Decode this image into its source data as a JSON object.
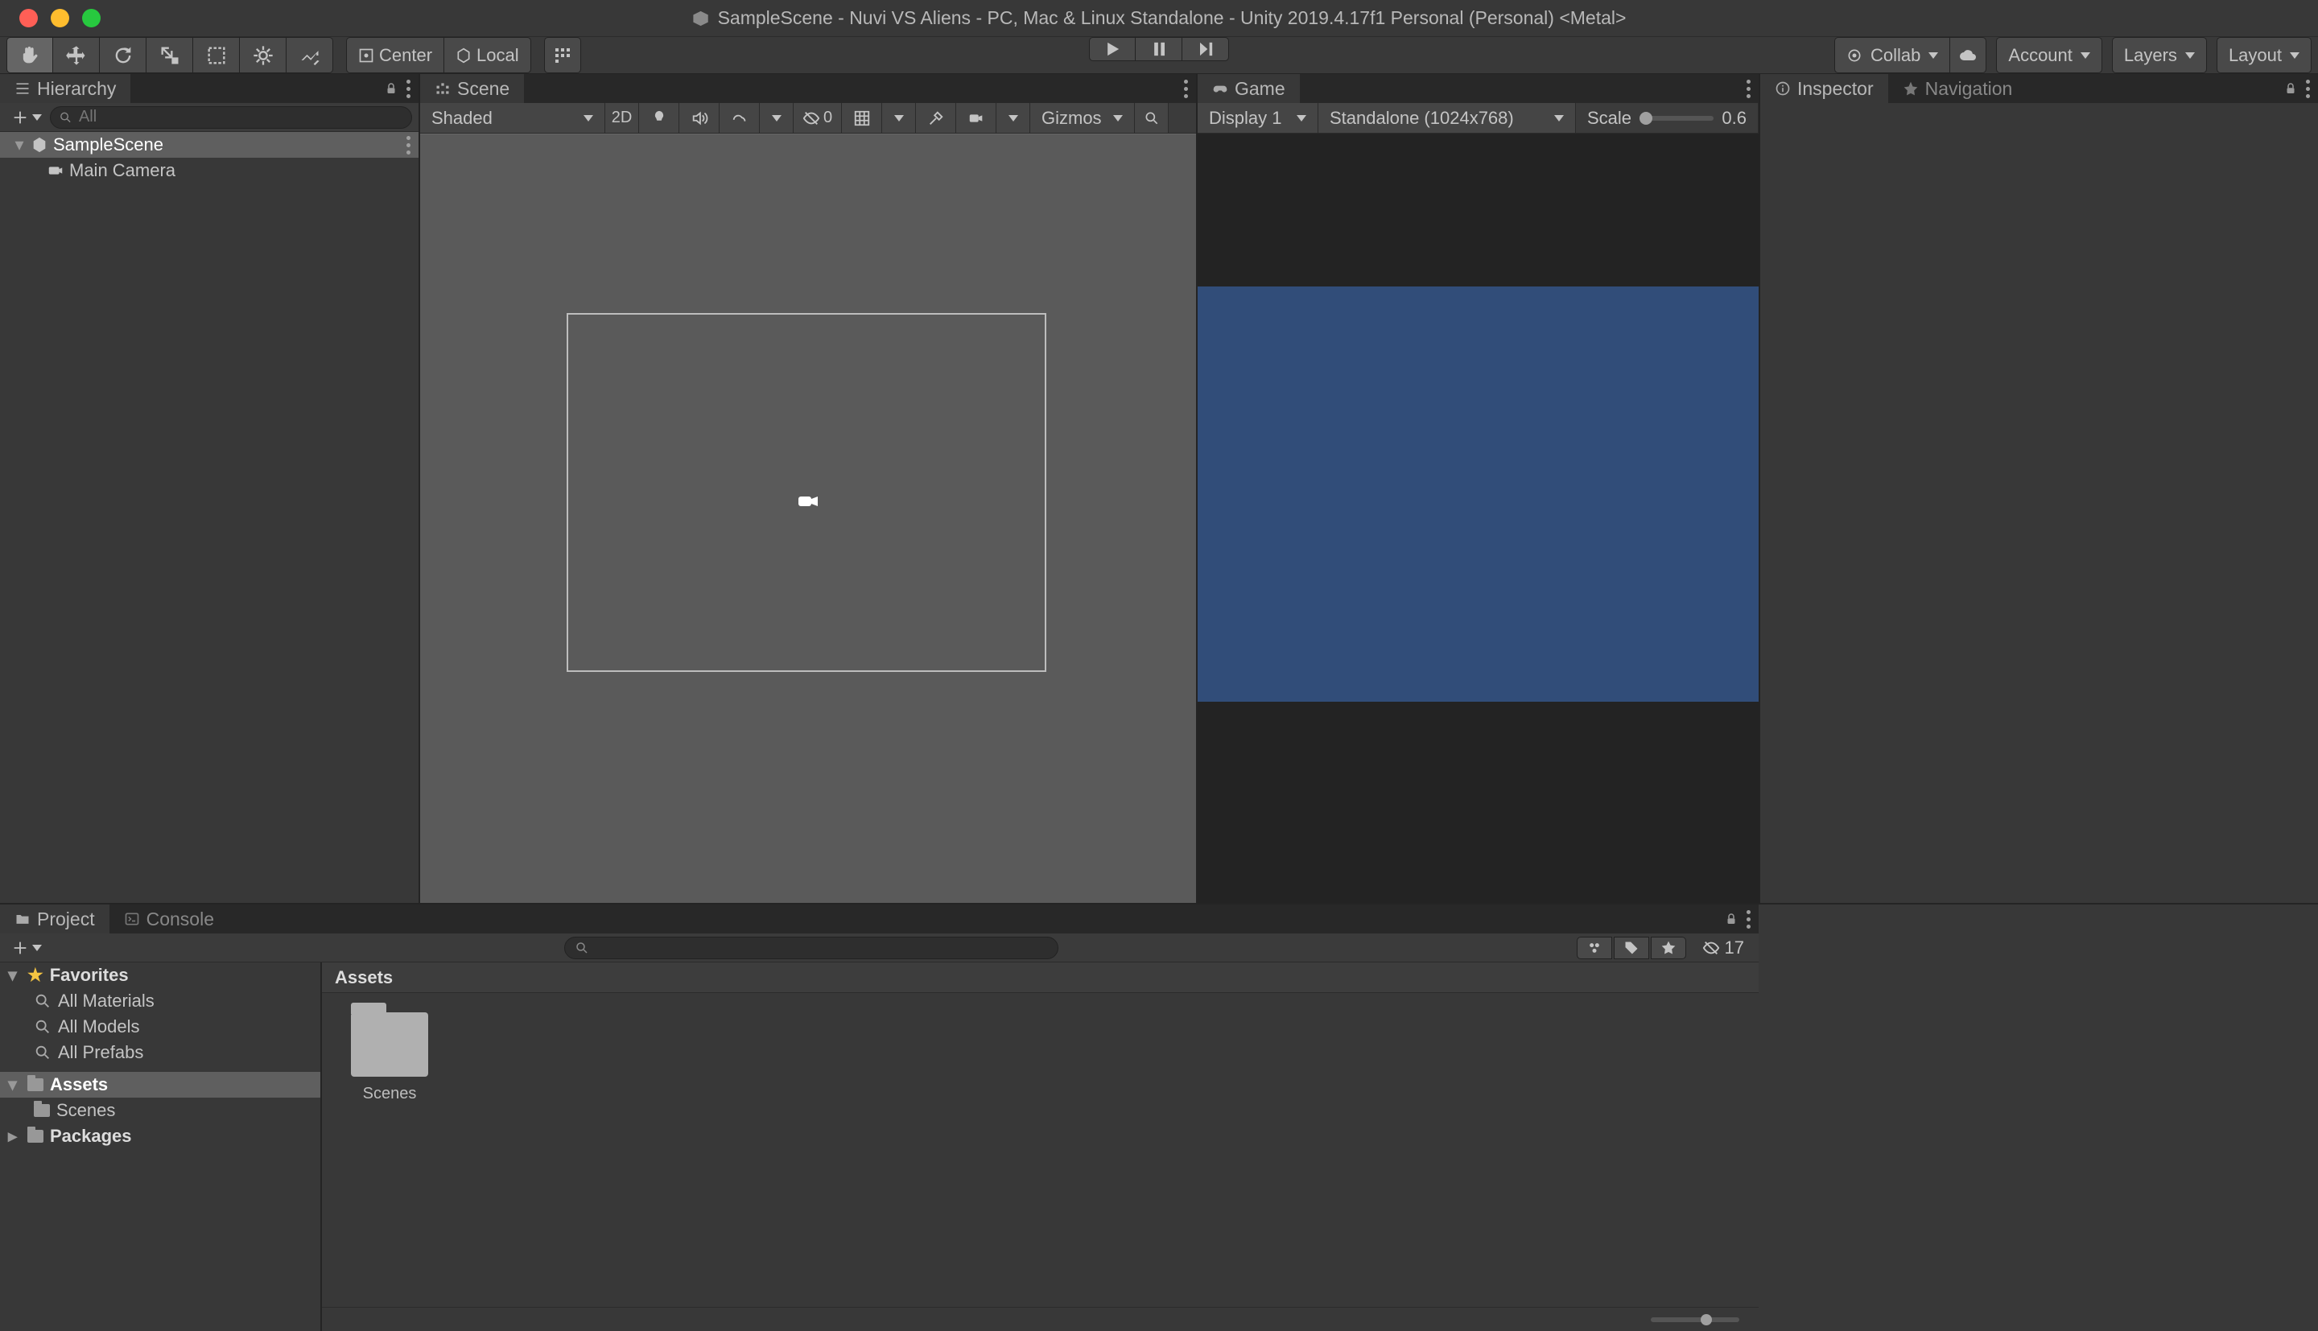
{
  "title_bar": {
    "title": "SampleScene - Nuvi VS Aliens - PC, Mac & Linux Standalone - Unity 2019.4.17f1 Personal (Personal) <Metal>"
  },
  "main_toolbar": {
    "pivot_center": "Center",
    "pivot_local": "Local",
    "collab": "Collab",
    "account": "Account",
    "layers": "Layers",
    "layout": "Layout"
  },
  "hierarchy": {
    "tab": "Hierarchy",
    "search_placeholder": "All",
    "items": [
      {
        "label": "SampleScene",
        "depth": 0,
        "icon": "scene",
        "expanded": true,
        "selected": true
      },
      {
        "label": "Main Camera",
        "depth": 1,
        "icon": "camera",
        "selected": false
      }
    ]
  },
  "scene": {
    "tab": "Scene",
    "shading": "Shaded",
    "mode2d": "2D",
    "hidden_count": "0",
    "gizmos": "Gizmos"
  },
  "game": {
    "tab": "Game",
    "display": "Display 1",
    "resolution": "Standalone (1024x768)",
    "scale_label": "Scale",
    "scale_value": "0.6",
    "bg_color": "#314d79"
  },
  "inspector": {
    "tab_inspector": "Inspector",
    "tab_navigation": "Navigation"
  },
  "project": {
    "tab_project": "Project",
    "tab_console": "Console",
    "hidden_count": "17",
    "breadcrumb": "Assets",
    "sidebar": {
      "favorites_label": "Favorites",
      "fav_items": [
        "All Materials",
        "All Models",
        "All Prefabs"
      ],
      "assets_label": "Assets",
      "assets_children": [
        "Scenes"
      ],
      "packages_label": "Packages"
    },
    "grid_items": [
      {
        "label": "Scenes",
        "type": "folder"
      }
    ]
  }
}
